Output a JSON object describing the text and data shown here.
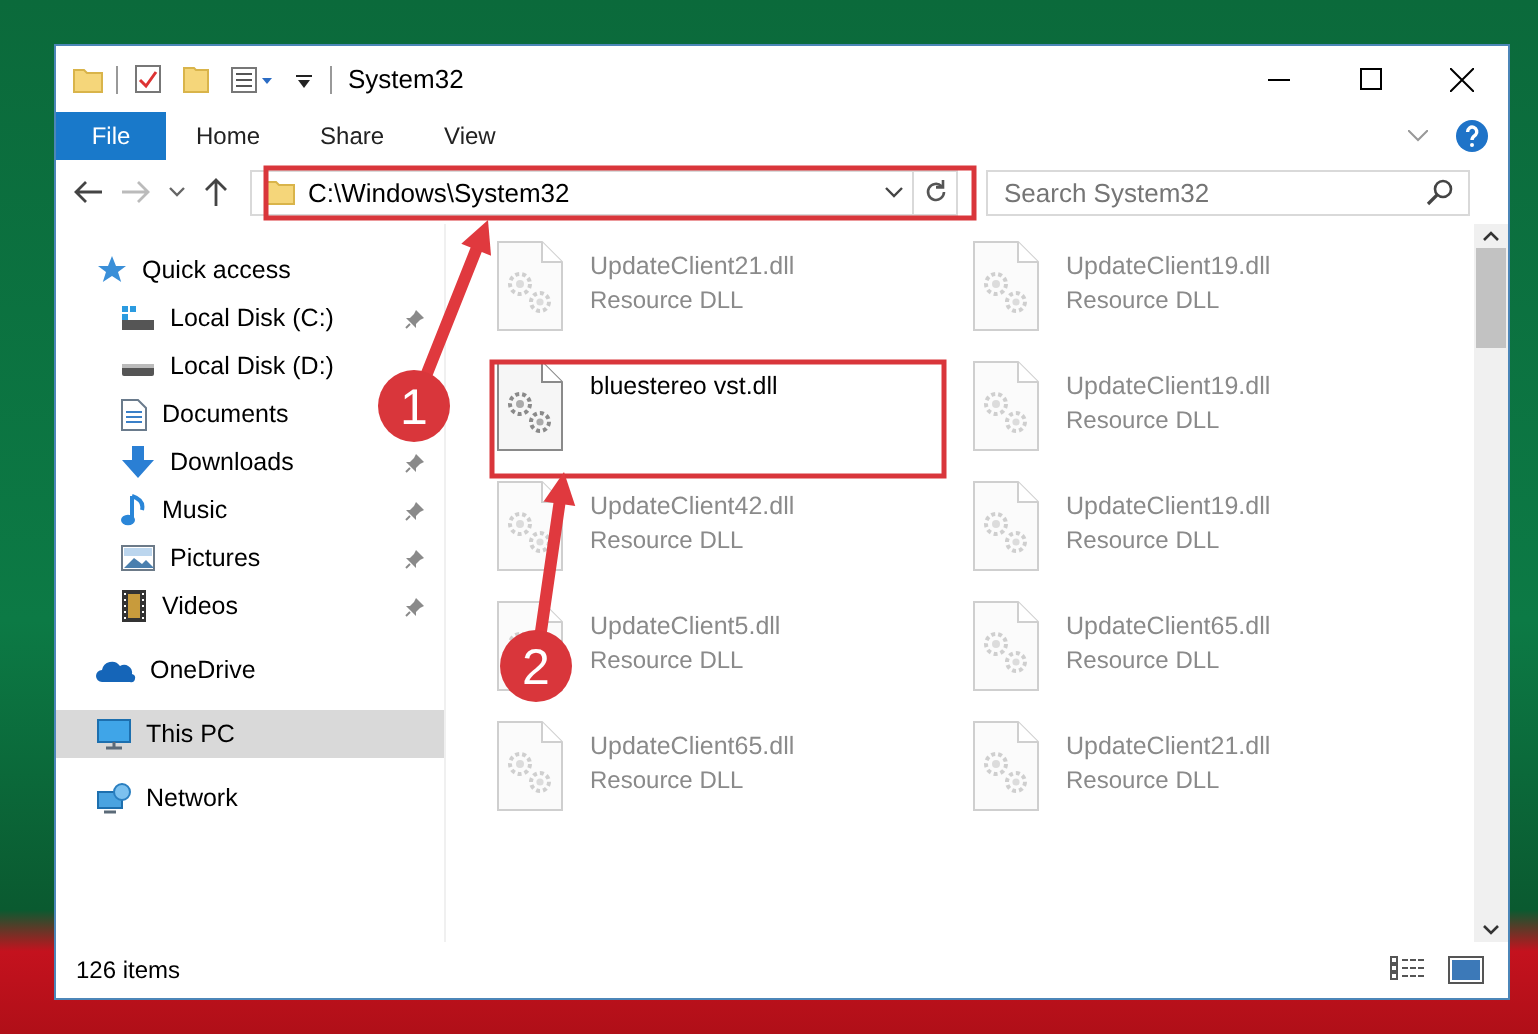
{
  "window": {
    "title": "System32"
  },
  "ribbon": {
    "tabs": [
      {
        "label": "File",
        "kind": "menu"
      },
      {
        "label": "Home",
        "kind": "tab"
      },
      {
        "label": "Share",
        "kind": "tab"
      },
      {
        "label": "View",
        "kind": "tab"
      }
    ]
  },
  "address_bar": {
    "path": "C:\\Windows\\System32"
  },
  "search": {
    "placeholder": "Search System32"
  },
  "sidebar": {
    "items": [
      {
        "label": "Quick access",
        "kind": "star",
        "selected": false,
        "children": [
          {
            "label": "Local Disk (C:)",
            "kind": "drive-system",
            "pinned": true,
            "selected": false
          },
          {
            "label": "Local Disk (D:)",
            "kind": "drive",
            "selected": false
          },
          {
            "label": "Documents",
            "kind": "documents",
            "selected": false
          },
          {
            "label": "Downloads",
            "kind": "downloads",
            "pinned": true,
            "selected": false
          },
          {
            "label": "Music",
            "kind": "music",
            "pinned": true,
            "selected": false
          },
          {
            "label": "Pictures",
            "kind": "pictures",
            "pinned": true,
            "selected": false
          },
          {
            "label": "Videos",
            "kind": "videos",
            "pinned": true,
            "selected": false
          }
        ]
      },
      {
        "label": "OneDrive",
        "kind": "cloud",
        "selected": false
      },
      {
        "label": "This PC",
        "kind": "computer",
        "selected": true
      },
      {
        "label": "Network",
        "kind": "network",
        "selected": false
      }
    ]
  },
  "files": [
    {
      "name": "UpdateClient21.dll",
      "type": "Resource DLL",
      "blurred": true
    },
    {
      "name": "UpdateClient19.dll",
      "type": "Resource DLL",
      "blurred": true
    },
    {
      "name": "bluestereo vst.dll",
      "blurred": false
    },
    {
      "name": "UpdateClient19.dll",
      "type": "Resource DLL",
      "blurred": true
    },
    {
      "name": "UpdateClient42.dll",
      "type": "Resource DLL",
      "blurred": true
    },
    {
      "name": "UpdateClient19.dll",
      "type": "Resource DLL",
      "blurred": true
    },
    {
      "name": "UpdateClient5.dll",
      "type": "Resource DLL",
      "blurred": true
    },
    {
      "name": "UpdateClient65.dll",
      "type": "Resource DLL",
      "blurred": true
    },
    {
      "name": "UpdateClient65.dll",
      "type": "Resource DLL",
      "blurred": true
    },
    {
      "name": "UpdateClient21.dll",
      "type": "Resource DLL",
      "blurred": true
    }
  ],
  "status_bar": {
    "item_count": "126 items"
  },
  "annotations": {
    "callouts": [
      {
        "label": "1"
      },
      {
        "label": "2"
      }
    ]
  }
}
